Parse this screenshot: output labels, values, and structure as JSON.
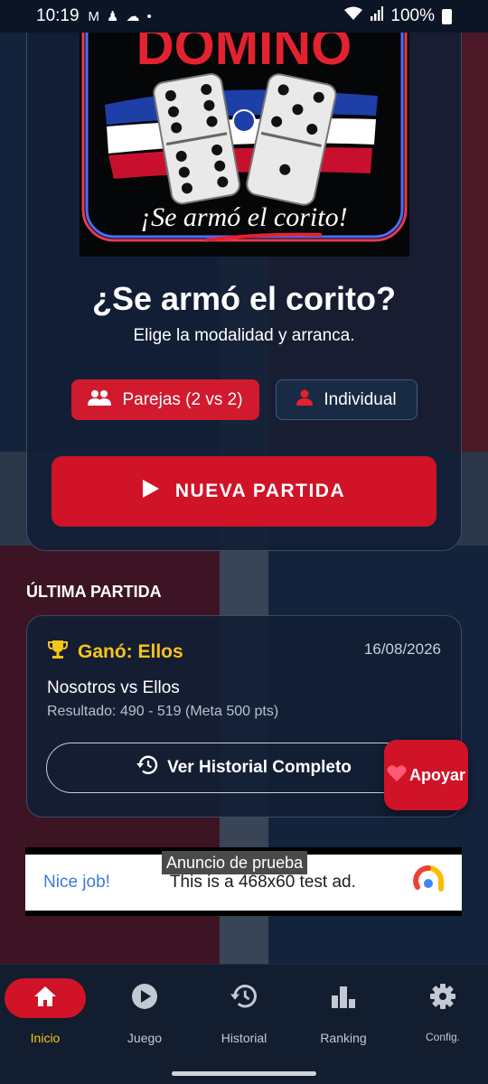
{
  "status_bar": {
    "time": "10:19",
    "battery": "100%"
  },
  "logo": {
    "title": "DOMINÓ",
    "slogan": "¡Se armó el corito!"
  },
  "hero": {
    "title": "¿Se armó el corito?",
    "subtitle": "Elige la modalidad y arranca."
  },
  "modes": {
    "pairs_label": "Parejas (2 vs 2)",
    "individual_label": "Individual",
    "selected": "pairs"
  },
  "new_game_label": "NUEVA PARTIDA",
  "last_game": {
    "section_title": "ÚLTIMA PARTIDA",
    "winner_text": "Ganó: Ellos",
    "date": "16/08/2026",
    "teams": "Nosotros vs Ellos",
    "result": "Resultado: 490 - 519 (Meta 500 pts)",
    "history_button": "Ver Historial Completo"
  },
  "support_button": "Apoyar",
  "ad": {
    "label": "Anuncio de prueba",
    "headline": "Nice job!",
    "text": "This is a 468x60 test ad."
  },
  "nav": {
    "items": [
      {
        "label": "Inicio",
        "icon": "home-icon",
        "active": true
      },
      {
        "label": "Juego",
        "icon": "play-circle-icon",
        "active": false
      },
      {
        "label": "Historial",
        "icon": "history-icon",
        "active": false
      },
      {
        "label": "Ranking",
        "icon": "bar-chart-icon",
        "active": false
      },
      {
        "label": "Config.",
        "icon": "gear-icon",
        "active": false
      }
    ]
  },
  "colors": {
    "accent_red": "#d01327",
    "winner_gold": "#f5c518",
    "background": "#0f1d33"
  }
}
